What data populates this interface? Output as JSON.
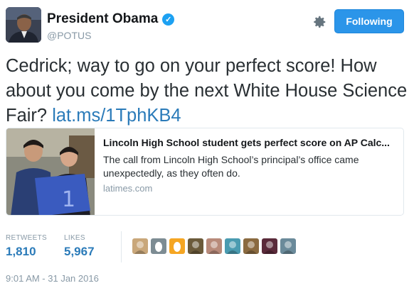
{
  "author": {
    "name": "President Obama",
    "handle": "@POTUS",
    "verified_icon": "check-icon"
  },
  "follow_button": {
    "label": "Following"
  },
  "tweet": {
    "text_before_link": "Cedrick; way to go on your perfect score! How about you come by the next White House Science Fair? ",
    "link_text": "lat.ms/1TphKB4"
  },
  "card": {
    "title": "Lincoln High School student gets perfect score on AP Calc...",
    "description": "The call from Lincoln High School’s principal’s office came unexpectedly, as they often do.",
    "domain": "latimes.com"
  },
  "stats": {
    "retweets_label": "RETWEETS",
    "retweets_value": "1,810",
    "likes_label": "LIKES",
    "likes_value": "5,967"
  },
  "likers": [
    {
      "color": "#c9a77a",
      "icon": "avatar-icon"
    },
    {
      "color": "#7d8c93",
      "icon": "egg-avatar-icon"
    },
    {
      "color": "#f5a623",
      "icon": "egg-avatar-icon"
    },
    {
      "color": "#6b5a3a",
      "icon": "avatar-icon"
    },
    {
      "color": "#b88a7a",
      "icon": "avatar-icon"
    },
    {
      "color": "#4a9bb0",
      "icon": "avatar-icon"
    },
    {
      "color": "#8a6a40",
      "icon": "avatar-icon"
    },
    {
      "color": "#5a2a3a",
      "icon": "avatar-icon"
    },
    {
      "color": "#6a8a9a",
      "icon": "avatar-icon"
    }
  ],
  "timestamp": "9:01 AM - 31 Jan 2016",
  "colors": {
    "link": "#2b7bb9",
    "button": "#2b95e9",
    "muted": "#8899a6"
  }
}
